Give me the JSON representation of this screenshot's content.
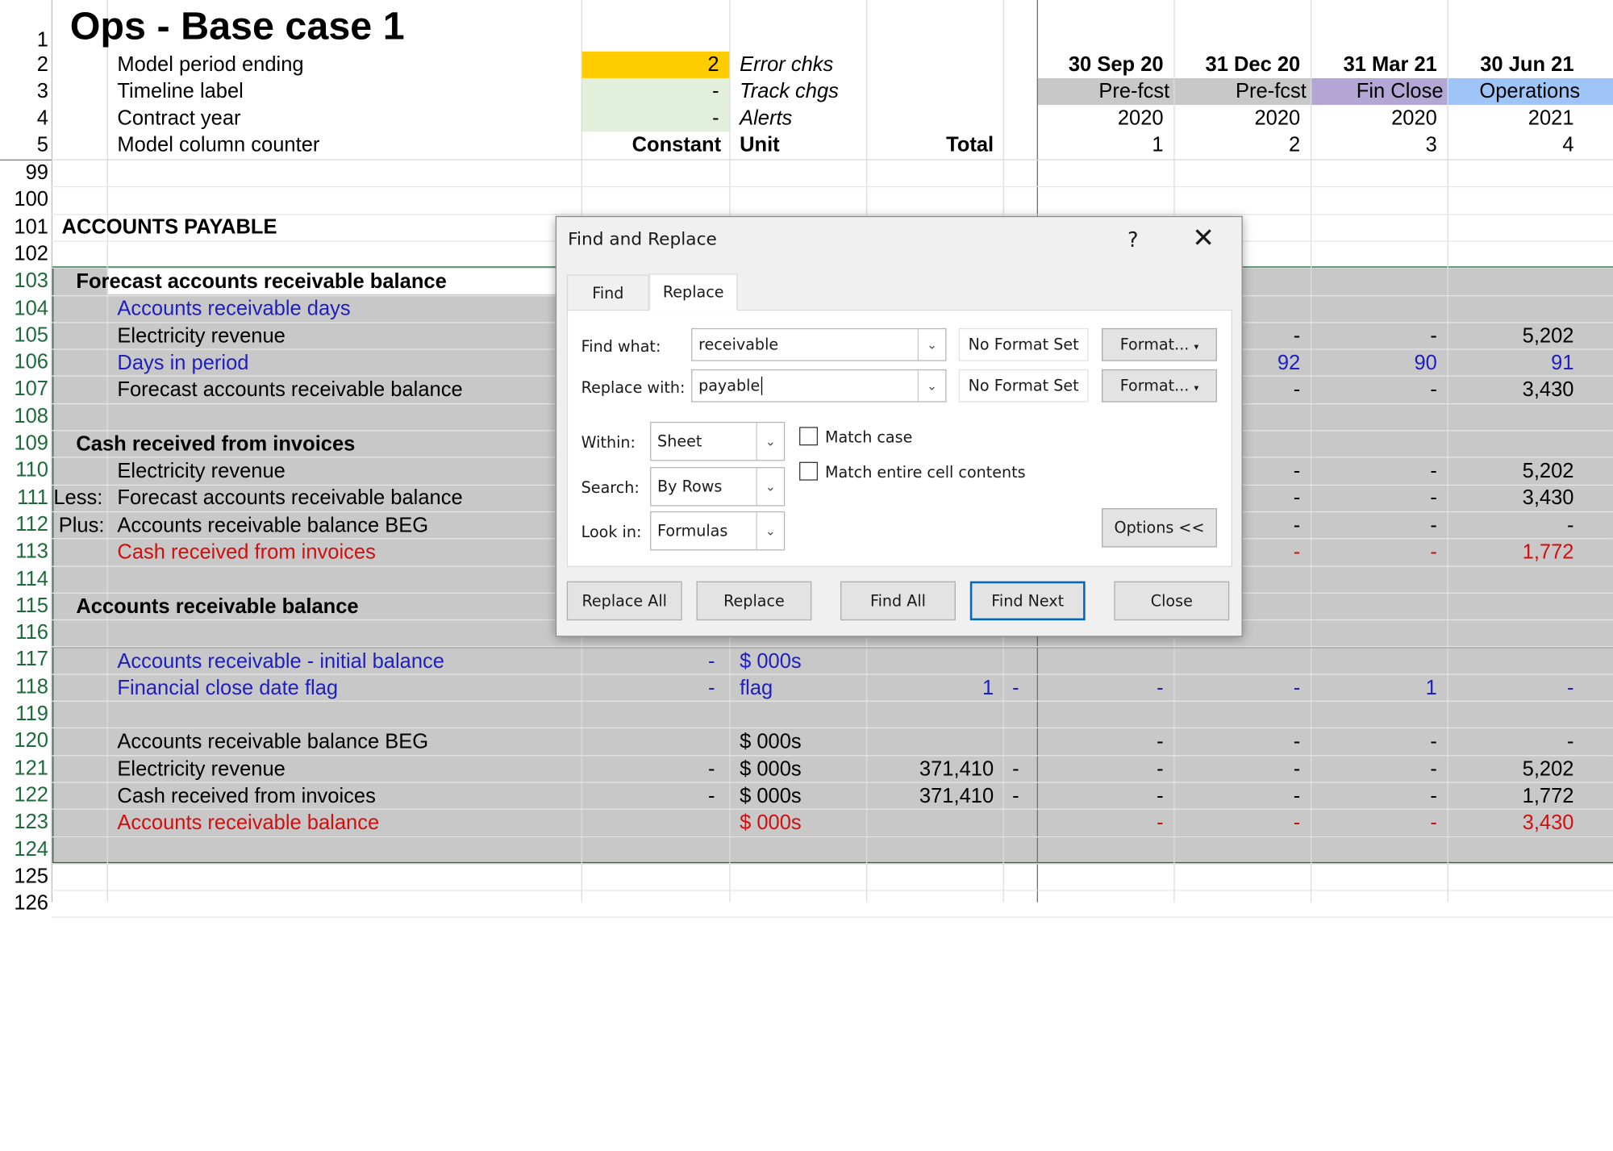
{
  "title": "Ops - Base case 1",
  "header_rows": [
    {
      "num": "1"
    },
    {
      "num": "2",
      "label": "Model period ending",
      "value": "2",
      "meta": "Error chks"
    },
    {
      "num": "3",
      "label": "Timeline label",
      "value": "-",
      "meta": "Track chgs"
    },
    {
      "num": "4",
      "label": "Contract year",
      "value": "-",
      "meta": "Alerts"
    },
    {
      "num": "5",
      "label": "Model column counter",
      "value": "Constant",
      "meta": "Unit",
      "total": "Total"
    }
  ],
  "timeline": {
    "dates": [
      "30 Sep 20",
      "31 Dec 20",
      "31 Mar 21",
      "30 Jun 21"
    ],
    "labels": [
      "Pre-fcst",
      "Pre-fcst",
      "Fin Close",
      "Operations"
    ],
    "years": [
      "2020",
      "2020",
      "2020",
      "2021"
    ],
    "counters": [
      "1",
      "2",
      "3",
      "4"
    ],
    "label_colors": [
      "#c8c8c8",
      "#c8c8c8",
      "#b4a7d6",
      "#9fc5f8"
    ]
  },
  "row_numbers": [
    "99",
    "100",
    "101",
    "102",
    "103",
    "104",
    "105",
    "106",
    "107",
    "108",
    "109",
    "110",
    "111",
    "112",
    "113",
    "114",
    "115",
    "116",
    "117",
    "118",
    "119",
    "120",
    "121",
    "122",
    "123",
    "124",
    "125",
    "126"
  ],
  "rows": {
    "r101": {
      "label": "ACCOUNTS PAYABLE"
    },
    "r103": {
      "label": "Forecast accounts receivable balance"
    },
    "r104": {
      "label": "Accounts receivable days"
    },
    "r105": {
      "label": "Electricity revenue",
      "c2": "-",
      "c3": "-",
      "c4": "5,202"
    },
    "r106": {
      "label": "Days in period",
      "c2": "92",
      "c3": "90",
      "c4": "91"
    },
    "r107": {
      "label": "Forecast accounts receivable balance",
      "c2": "-",
      "c3": "-",
      "c4": "3,430"
    },
    "r109": {
      "label": "Cash received from invoices"
    },
    "r110": {
      "label": "Electricity revenue",
      "c2": "-",
      "c3": "-",
      "c4": "5,202"
    },
    "r111": {
      "prefix": "Less:",
      "label": "Forecast accounts receivable balance",
      "c2": "-",
      "c3": "-",
      "c4": "3,430"
    },
    "r112": {
      "prefix": "Plus:",
      "label": "Accounts receivable balance BEG",
      "c2": "-",
      "c3": "-",
      "c4": "-"
    },
    "r113": {
      "label": "Cash received from invoices",
      "c2": "-",
      "c3": "-",
      "c4": "1,772"
    },
    "r115": {
      "label": "Accounts receivable balance"
    },
    "r117": {
      "label": "Accounts receivable - initial balance",
      "const": "-",
      "unit": "$ 000s"
    },
    "r118": {
      "label": "Financial close date flag",
      "const": "-",
      "unit": "flag",
      "total": "1",
      "x": "-",
      "c1": "-",
      "c2": "-",
      "c3": "1",
      "c4": "-"
    },
    "r120": {
      "label": "Accounts receivable balance BEG",
      "unit": "$ 000s",
      "c1": "-",
      "c2": "-",
      "c3": "-",
      "c4": "-"
    },
    "r121": {
      "label": "Electricity revenue",
      "const": "-",
      "unit": "$ 000s",
      "total": "371,410",
      "x": "-",
      "c1": "-",
      "c2": "-",
      "c3": "-",
      "c4": "5,202"
    },
    "r122": {
      "label": "Cash received from invoices",
      "const": "-",
      "unit": "$ 000s",
      "total": "371,410",
      "x": "-",
      "c1": "-",
      "c2": "-",
      "c3": "-",
      "c4": "1,772"
    },
    "r123": {
      "label": "Accounts receivable balance",
      "unit": "$ 000s",
      "c1": "-",
      "c2": "-",
      "c3": "-",
      "c4": "3,430"
    }
  },
  "dialog": {
    "title": "Find and Replace",
    "help": "?",
    "close": "✕",
    "tabs": [
      "Find",
      "Replace"
    ],
    "find_label": "Find what:",
    "find_value": "receivable",
    "replace_label": "Replace with:",
    "replace_value": "payable",
    "no_format": "No Format Set",
    "format_btn": "Format...",
    "within_label": "Within:",
    "within_value": "Sheet",
    "search_label": "Search:",
    "search_value": "By Rows",
    "lookin_label": "Look in:",
    "lookin_value": "Formulas",
    "match_case": "Match case",
    "match_entire": "Match entire cell contents",
    "options_btn": "Options <<",
    "buttons": [
      "Replace All",
      "Replace",
      "Find All",
      "Find Next",
      "Close"
    ]
  },
  "colors": {
    "selection_gray": "#c8c8c8",
    "highlight_yellow": "#ffcc00",
    "input_green": "#e2efda",
    "blue_text": "#1f1fbf",
    "red_text": "#d10f0f",
    "accent": "#0067c0"
  }
}
